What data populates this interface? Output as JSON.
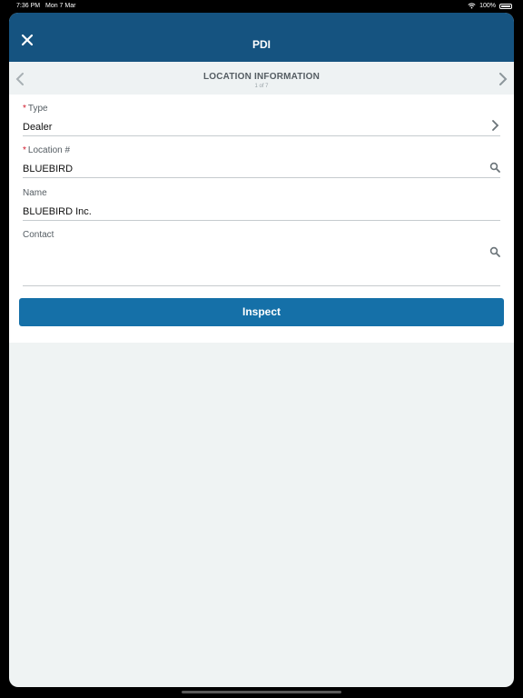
{
  "status_bar": {
    "time": "7:36 PM",
    "date": "Mon 7 Mar",
    "battery": "100%"
  },
  "nav": {
    "title": "PDI",
    "close_icon": "close-icon"
  },
  "section": {
    "title": "LOCATION INFORMATION",
    "page": "1 of 7"
  },
  "fields": [
    {
      "label": "Type",
      "required": true,
      "value": "Dealer",
      "icon": "chevron-right-icon"
    },
    {
      "label": "Location #",
      "required": true,
      "value": "BLUEBIRD",
      "icon": "search-icon"
    },
    {
      "label": "Name",
      "required": false,
      "value": "BLUEBIRD Inc.",
      "icon": ""
    },
    {
      "label": "Contact",
      "required": false,
      "value": "",
      "icon": "search-icon"
    }
  ],
  "inspect_button": "Inspect",
  "colors": {
    "nav_background": "#155380",
    "button_background": "#1570a8",
    "required_mark": "#d0182a",
    "page_background": "#eff3f3"
  }
}
